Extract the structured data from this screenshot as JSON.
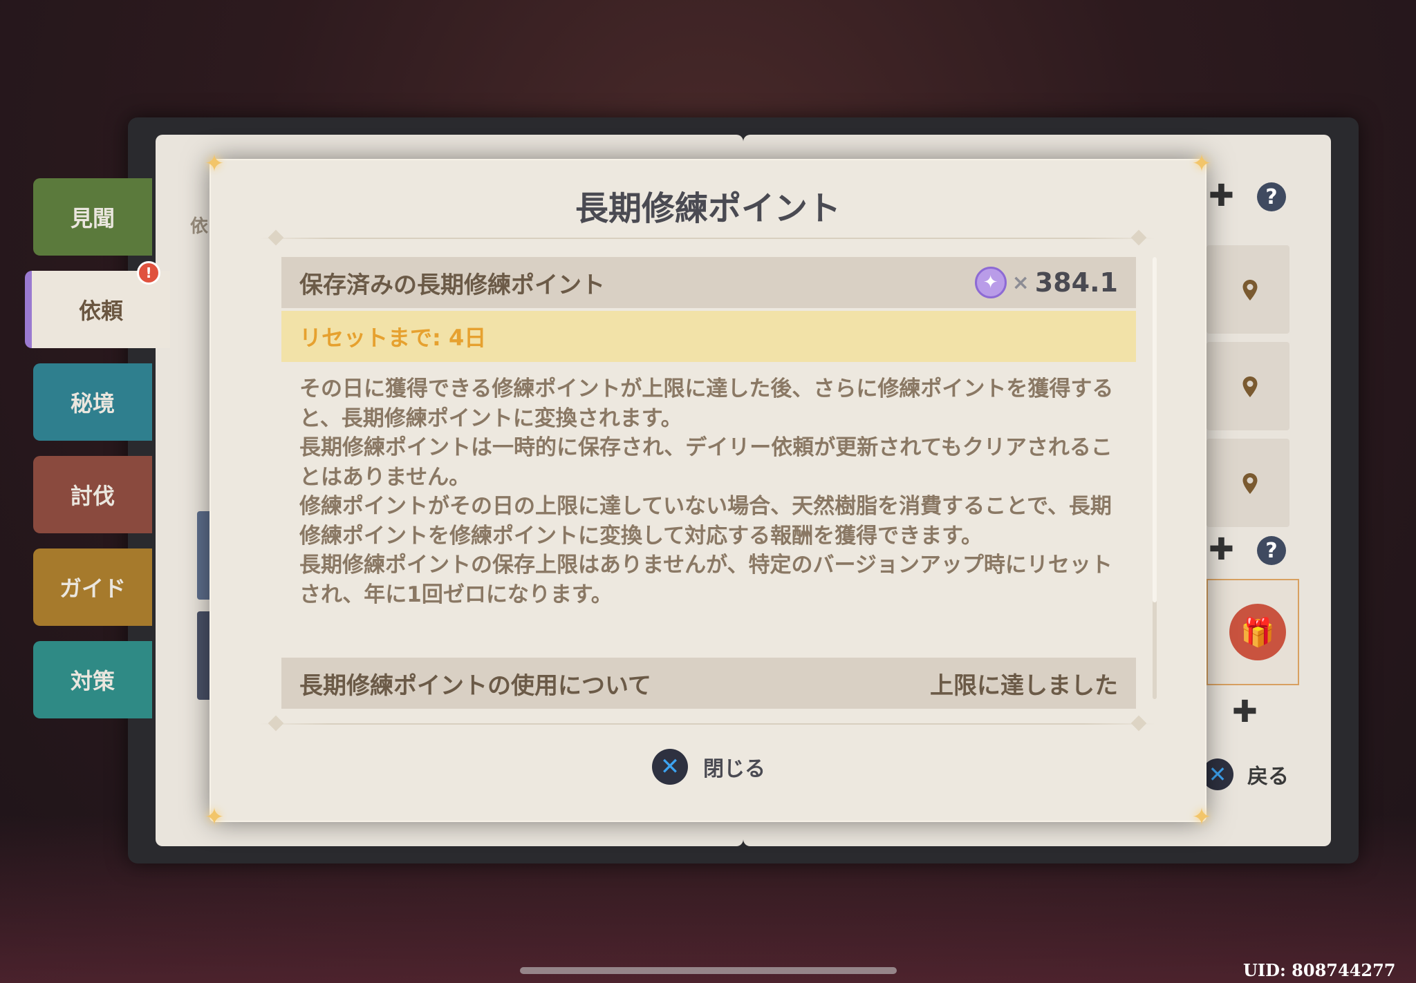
{
  "side_tabs": [
    {
      "label": "見聞",
      "color": "#5b7a3c"
    },
    {
      "label": "依頼",
      "color": "#ece6dc",
      "active": true,
      "badge": "!"
    },
    {
      "label": "秘境",
      "color": "#2f7f8e"
    },
    {
      "label": "討伐",
      "color": "#8a4a3e"
    },
    {
      "label": "ガイド",
      "color": "#a67a2c"
    },
    {
      "label": "対策",
      "color": "#2f8a85"
    }
  ],
  "left_page_partial_text": "依",
  "right_panel": {
    "icons": [
      "location-pin-icon",
      "location-pin-icon",
      "location-pin-icon"
    ],
    "gift_icon": "gift-icon",
    "back_label": "戻る"
  },
  "modal": {
    "title": "長期修練ポイント",
    "stored_label": "保存済みの長期修練ポイント",
    "points_times": "×",
    "points_value": "384.1",
    "reset_label": "リセットまで: 4日",
    "description": [
      "その日に獲得できる修練ポイントが上限に達した後、さらに修練ポイントを獲得すると、長期修練ポイントに変換されます。",
      "長期修練ポイントは一時的に保存され、デイリー依頼が更新されてもクリアされることはありません。",
      "修練ポイントがその日の上限に達していない場合、天然樹脂を消費することで、長期修練ポイントを修練ポイントに変換して対応する報酬を獲得できます。",
      "長期修練ポイントの保存上限はありませんが、特定のバージョンアップ時にリセットされ、年に1回ゼロになります。"
    ],
    "usage_label": "長期修練ポイントの使用について",
    "usage_status": "上限に達しました",
    "close_label": "閉じる"
  },
  "uid": "UID: 808744277",
  "colors": {
    "accent_gold": "#e6a12f",
    "close_x": "#3da3f0"
  }
}
